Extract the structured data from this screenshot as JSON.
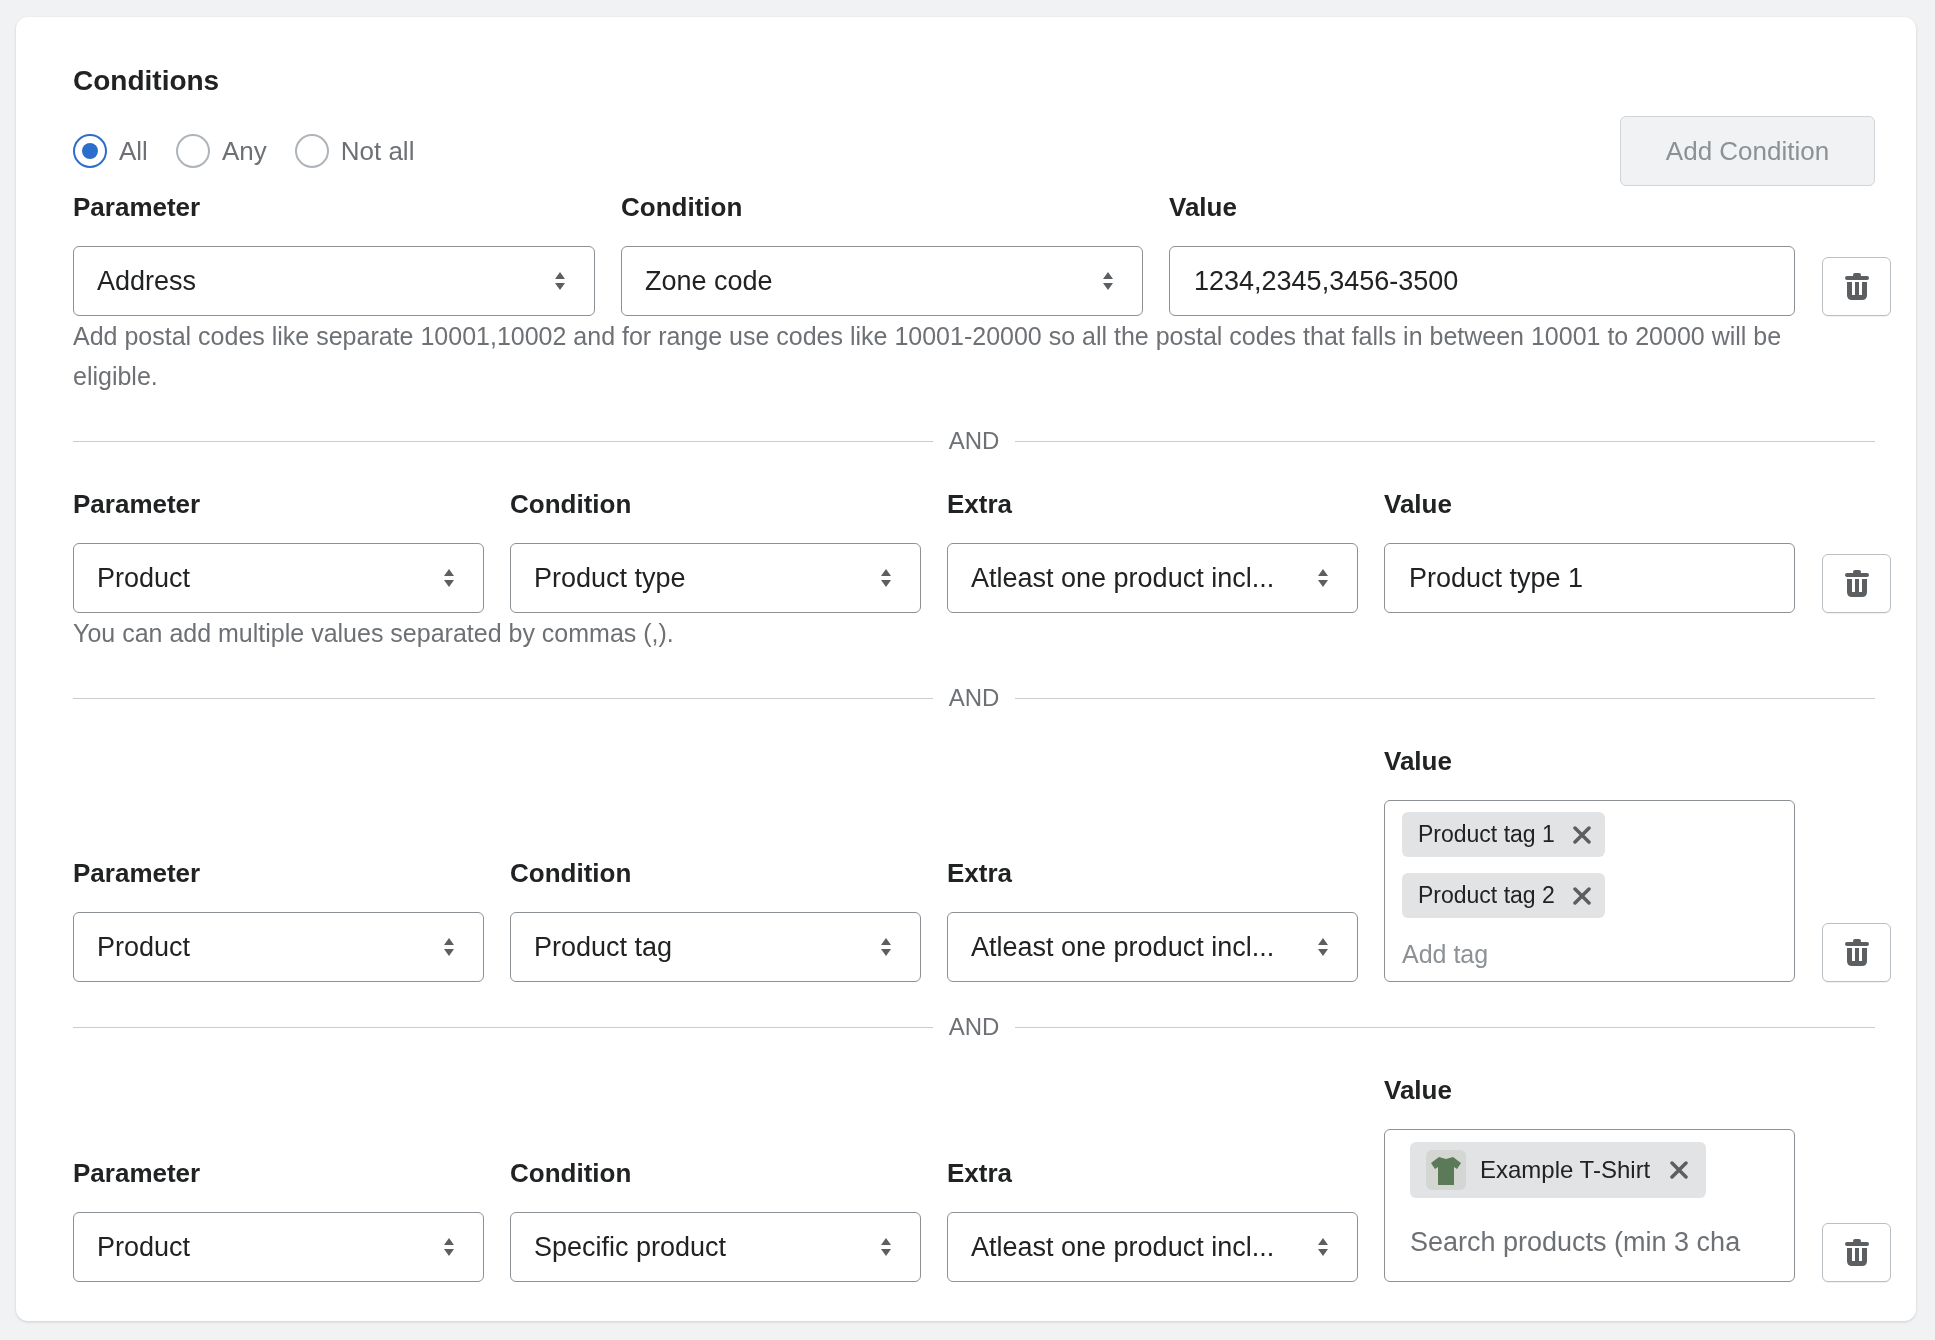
{
  "title": "Conditions",
  "match_options": [
    {
      "label": "All",
      "selected": true
    },
    {
      "label": "Any",
      "selected": false
    },
    {
      "label": "Not all",
      "selected": false
    }
  ],
  "add_button": {
    "label": "Add Condition",
    "disabled": true
  },
  "rows": [
    {
      "fields": [
        {
          "kind": "select",
          "label": "Parameter",
          "value": "Address"
        },
        {
          "kind": "select",
          "label": "Condition",
          "value": "Zone code"
        },
        {
          "kind": "text",
          "label": "Value",
          "value": "1234,2345,3456-3500"
        }
      ],
      "help": "Add postal codes like separate 10001,10002 and for range use codes like 10001-20000 so all the postal codes that falls in between 10001 to 20000 will be eligible."
    },
    {
      "joiner": "AND",
      "fields": [
        {
          "kind": "select",
          "label": "Parameter",
          "value": "Product"
        },
        {
          "kind": "select",
          "label": "Condition",
          "value": "Product type"
        },
        {
          "kind": "select",
          "label": "Extra",
          "value": "Atleast one product incl..."
        },
        {
          "kind": "text",
          "label": "Value",
          "value": "Product type 1"
        }
      ],
      "help": "You can add multiple values separated by commas (,)."
    },
    {
      "joiner": "AND",
      "fields": [
        {
          "kind": "select",
          "label": "Parameter",
          "value": "Product"
        },
        {
          "kind": "select",
          "label": "Condition",
          "value": "Product tag"
        },
        {
          "kind": "select",
          "label": "Extra",
          "value": "Atleast one product incl..."
        },
        {
          "kind": "tags",
          "label": "Value",
          "tags": [
            {
              "label": "Product tag 1"
            },
            {
              "label": "Product tag 2"
            }
          ],
          "placeholder": "Add tag"
        }
      ]
    },
    {
      "joiner": "AND",
      "fields": [
        {
          "kind": "select",
          "label": "Parameter",
          "value": "Product"
        },
        {
          "kind": "select",
          "label": "Condition",
          "value": "Specific product"
        },
        {
          "kind": "select",
          "label": "Extra",
          "value": "Atleast one product incl..."
        },
        {
          "kind": "products",
          "label": "Value",
          "items": [
            {
              "label": "Example T-Shirt"
            }
          ],
          "placeholder": "Search products (min 3 cha"
        }
      ]
    }
  ]
}
